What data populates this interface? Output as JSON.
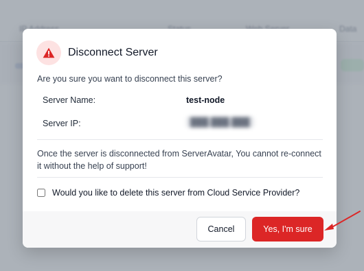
{
  "background": {
    "columns": [
      "IP Address",
      "Status",
      "Web Server",
      "Data"
    ]
  },
  "modal": {
    "title": "Disconnect Server",
    "icon": "warning-triangle-icon",
    "question": "Are you sure you want to disconnect this server?",
    "server_name_label": "Server Name:",
    "server_name_value": "test-node",
    "server_ip_label": "Server IP:",
    "server_ip_value": "███.███.███",
    "note": "Once the server is disconnected from ServerAvatar, You cannot re-connect it without the help of support!",
    "delete_checkbox_label": "Would you like to delete this server from Cloud Service Provider?",
    "delete_checkbox_checked": false,
    "cancel_label": "Cancel",
    "confirm_label": "Yes, I'm sure"
  },
  "colors": {
    "danger": "#dc2626",
    "danger_soft": "#fde2e2",
    "annotation_arrow": "#dc2626"
  }
}
